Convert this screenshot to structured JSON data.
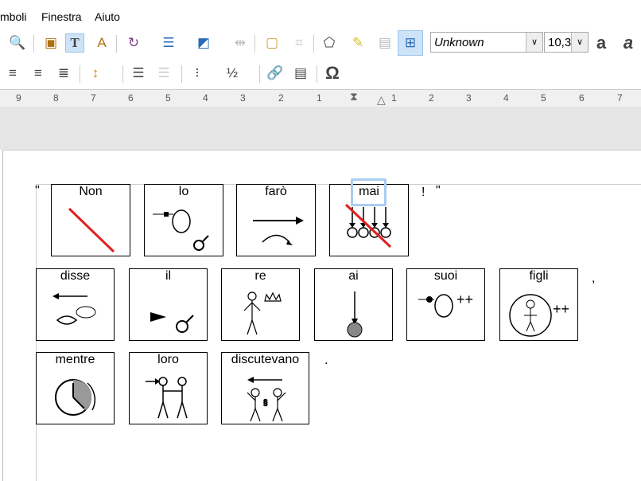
{
  "menu": [
    "mboli",
    "Finestra",
    "Aiuto"
  ],
  "toolbar": {
    "font_name": "Unknown",
    "font_size": "10,3"
  },
  "ruler": [
    "9",
    "8",
    "7",
    "6",
    "5",
    "4",
    "3",
    "2",
    "1",
    "1",
    "2",
    "3",
    "4",
    "5",
    "6",
    "7"
  ],
  "punctuation": [
    "\"",
    "!",
    "\"",
    ",",
    "."
  ],
  "cards": [
    {
      "word": "Non",
      "icon": "negation-line"
    },
    {
      "word": "lo",
      "icon": "object-male"
    },
    {
      "word": "farò",
      "icon": "future-arrow"
    },
    {
      "word": "mai",
      "icon": "never-clocks",
      "highlighted": true
    },
    {
      "word": "disse",
      "icon": "say-mouth"
    },
    {
      "word": "il",
      "icon": "article-male"
    },
    {
      "word": "re",
      "icon": "king-figure"
    },
    {
      "word": "ai",
      "icon": "to-ball"
    },
    {
      "word": "suoi",
      "icon": "his-plural"
    },
    {
      "word": "figli",
      "icon": "child-plural"
    },
    {
      "word": "mentre",
      "icon": "while-clock"
    },
    {
      "word": "loro",
      "icon": "they-people"
    },
    {
      "word": "discutevano",
      "icon": "discuss-people"
    }
  ],
  "colors": {
    "negation": "#e02020",
    "highlight": "#a9cdf0",
    "toolbar_selected": "#cde3f7"
  }
}
